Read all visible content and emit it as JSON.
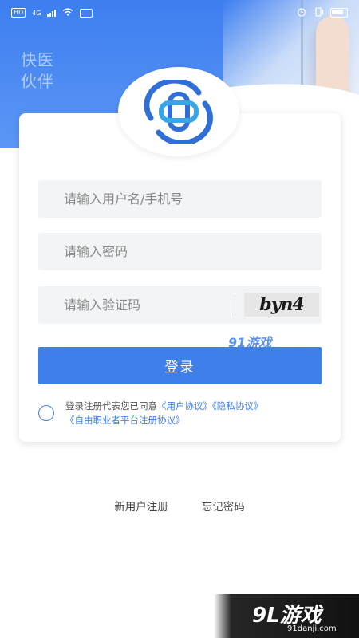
{
  "status_bar": {
    "left_badges": [
      "HD",
      "4G"
    ],
    "signal_icon": "signal-bars-icon",
    "wifi_icon": "wifi-icon",
    "right_icons": [
      "alarm-icon",
      "vibrate-icon",
      "battery-icon"
    ]
  },
  "hero": {
    "slogan_line1": "快医",
    "slogan_line2": "伙伴"
  },
  "login_form": {
    "username_placeholder": "请输入用户名/手机号",
    "password_placeholder": "请输入密码",
    "captcha_placeholder": "请输入验证码",
    "captcha_text": "byn4",
    "login_label": "登录"
  },
  "agreement": {
    "prefix": "登录注册代表您已同意",
    "user_agreement": "《用户协议》",
    "privacy_policy": "《隐私协议》",
    "freelancer_agreement": "《自由职业者平台注册协议》",
    "checked": false
  },
  "bottom_links": {
    "register": "新用户注册",
    "forgot_password": "忘记密码"
  },
  "watermarks": {
    "mid_main": "91游戏",
    "mid_sub": "91danji.com",
    "bottom_main": "9L游戏",
    "bottom_sub": "91danji.com"
  },
  "colors": {
    "primary": "#3f7fea",
    "hero_top": "#3d7ef0",
    "field_bg": "#f3f4f6"
  }
}
